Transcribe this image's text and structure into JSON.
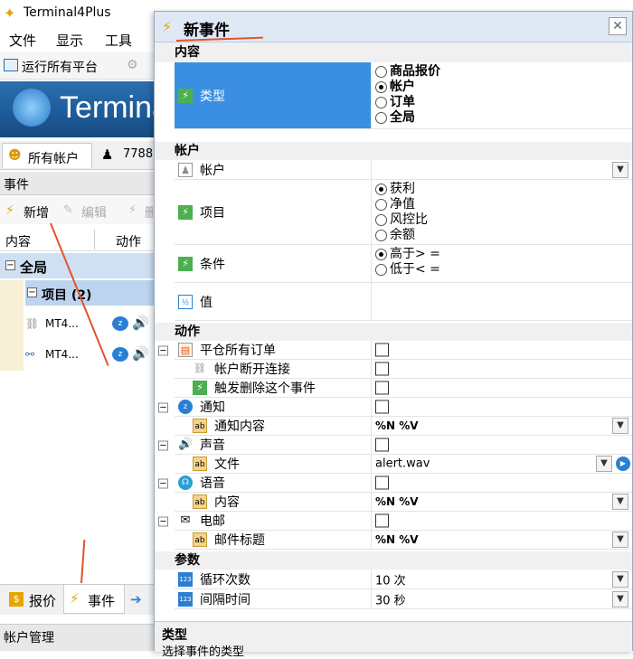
{
  "app": {
    "title": "Terminal4Plus",
    "menu": [
      "文件",
      "显示",
      "工具"
    ],
    "toolbar_run": "运行所有平台",
    "banner": "Termina",
    "tabs": {
      "all_accounts": "所有帐户",
      "account_partial": "7788"
    },
    "panel_title": "事件",
    "event_toolbar": {
      "new": "新增",
      "edit": "编辑",
      "delete_partial": "删"
    },
    "columns": {
      "content": "内容",
      "action": "动作"
    },
    "group": "全局",
    "subgroup": "项目 (2)",
    "items": [
      {
        "label": "MT4..."
      },
      {
        "label": "MT4..."
      }
    ],
    "bottom_tabs": {
      "quotes": "报价",
      "events": "事件"
    },
    "account_mgmt": "帐户管理"
  },
  "dialog": {
    "title": "新事件",
    "close": "✕",
    "sections": {
      "content": "内容",
      "account": "帐户",
      "action": "动作",
      "params": "参数"
    },
    "type": {
      "label": "类型",
      "options": [
        "商品报价",
        "帐户",
        "订单",
        "全局"
      ],
      "selected": 1
    },
    "account_field": {
      "label": "帐户",
      "value": ""
    },
    "item": {
      "label": "项目",
      "options": [
        "获利",
        "净值",
        "风控比",
        "余额"
      ],
      "selected": 0
    },
    "condition": {
      "label": "条件",
      "options": [
        "高于> =",
        "低于< ="
      ],
      "selected": 0
    },
    "value": {
      "label": "值",
      "value": ""
    },
    "actions": {
      "close_all": "平仓所有订单",
      "disconnect": "帐户断开连接",
      "trigger_delete": "触发删除这个事件",
      "notify": "通知",
      "notify_content": {
        "label": "通知内容",
        "value": "%N %V"
      },
      "sound": "声音",
      "sound_file": {
        "label": "文件",
        "value": "alert.wav"
      },
      "voice": "语音",
      "voice_content": {
        "label": "内容",
        "value": "%N %V"
      },
      "email": "电邮",
      "email_subject": {
        "label": "邮件标题",
        "value": "%N %V"
      }
    },
    "params": {
      "loop": {
        "label": "循环次数",
        "value": "10 次"
      },
      "interval": {
        "label": "间隔时间",
        "value": "30 秒"
      }
    },
    "help": {
      "title": "类型",
      "desc": "选择事件的类型"
    }
  },
  "colors": {
    "selection": "#3b8fe2",
    "annotation_arrow": "#e0542e"
  }
}
